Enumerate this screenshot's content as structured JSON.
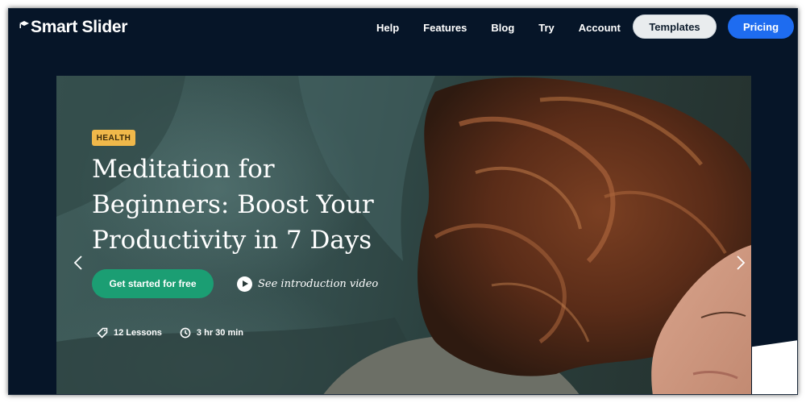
{
  "nav": {
    "logo_text": "Smart Slider",
    "links": [
      "Help",
      "Features",
      "Blog",
      "Try",
      "Account"
    ],
    "templates_label": "Templates",
    "pricing_label": "Pricing"
  },
  "hero": {
    "badge": "HEALTH",
    "headline": "Meditation for Beginners: Boost Your Productivity in 7 Days",
    "cta_label": "Get started for free",
    "video_label": "See introduction video",
    "lessons": "12 Lessons",
    "duration": "3 hr 30 min"
  },
  "icons": {
    "logo": "graduation-cap-icon",
    "lessons": "tag-icon",
    "duration": "clock-icon",
    "play": "play-icon",
    "prev": "chevron-left-icon",
    "next": "chevron-right-icon"
  },
  "colors": {
    "background": "#061528",
    "pricing_button": "#1e6cf0",
    "cta_button": "#1b9e73",
    "badge": "#f0b84a"
  }
}
